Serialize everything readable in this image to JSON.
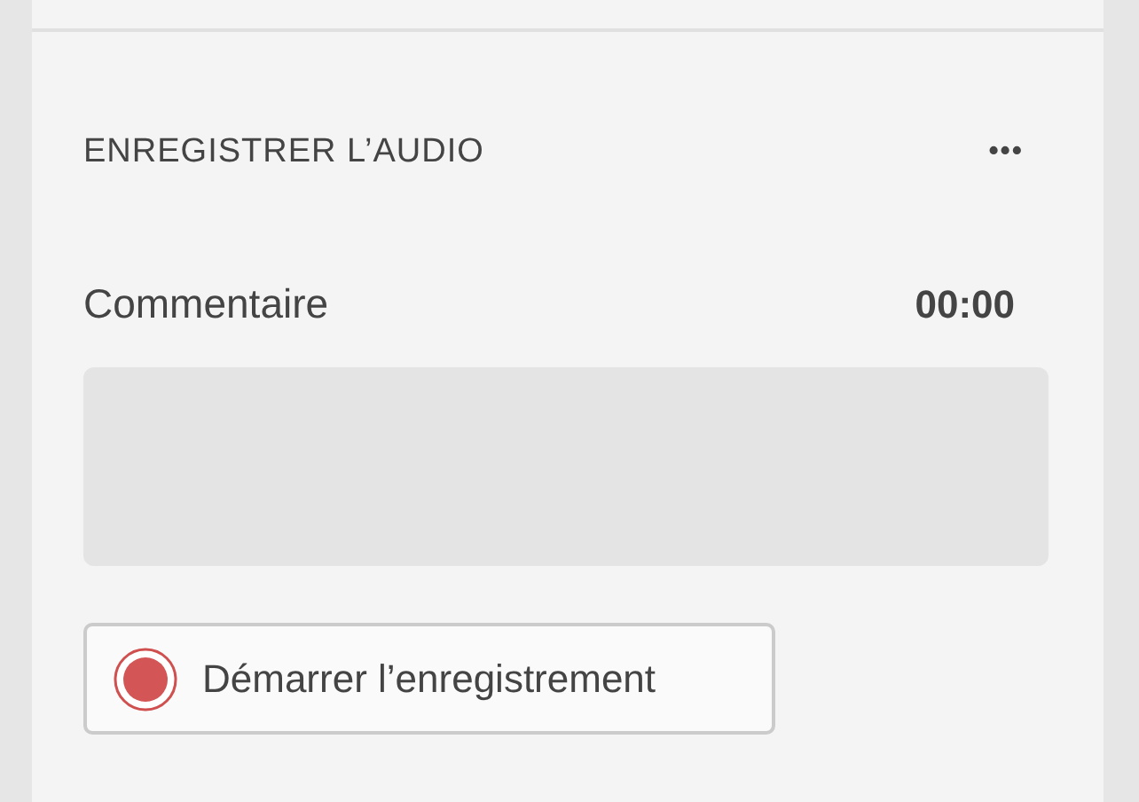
{
  "section": {
    "title": "ENREGISTRER L’AUDIO",
    "menu_icon": "•••"
  },
  "comment": {
    "label": "Commentaire",
    "time": "00:00"
  },
  "record_button": {
    "label": "Démarrer l’enregistrement"
  }
}
